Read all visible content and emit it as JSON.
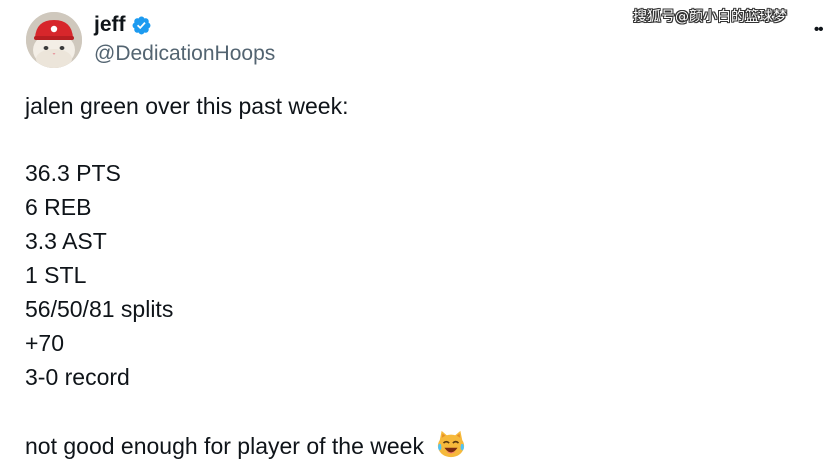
{
  "author": {
    "display_name": "jeff",
    "handle": "@DedicationHoops",
    "verified_icon": "verified-badge-icon",
    "avatar_icon": "cat-in-red-cap-avatar"
  },
  "watermark": "搜狐号@颜小白的篮球梦",
  "tweet": {
    "intro": "jalen green over this past week:",
    "stats": [
      "36.3 PTS",
      "6 REB",
      "3.3 AST",
      "1 STL",
      "56/50/81 splits",
      "+70",
      "3-0 record"
    ],
    "outro": "not good enough for player of the week",
    "emoji": "crying-laughing-cat-emoji"
  },
  "colors": {
    "verified_blue": "#1d9bf0",
    "text_primary": "#0f1419",
    "text_secondary": "#536471",
    "cap_red": "#d7262b"
  }
}
